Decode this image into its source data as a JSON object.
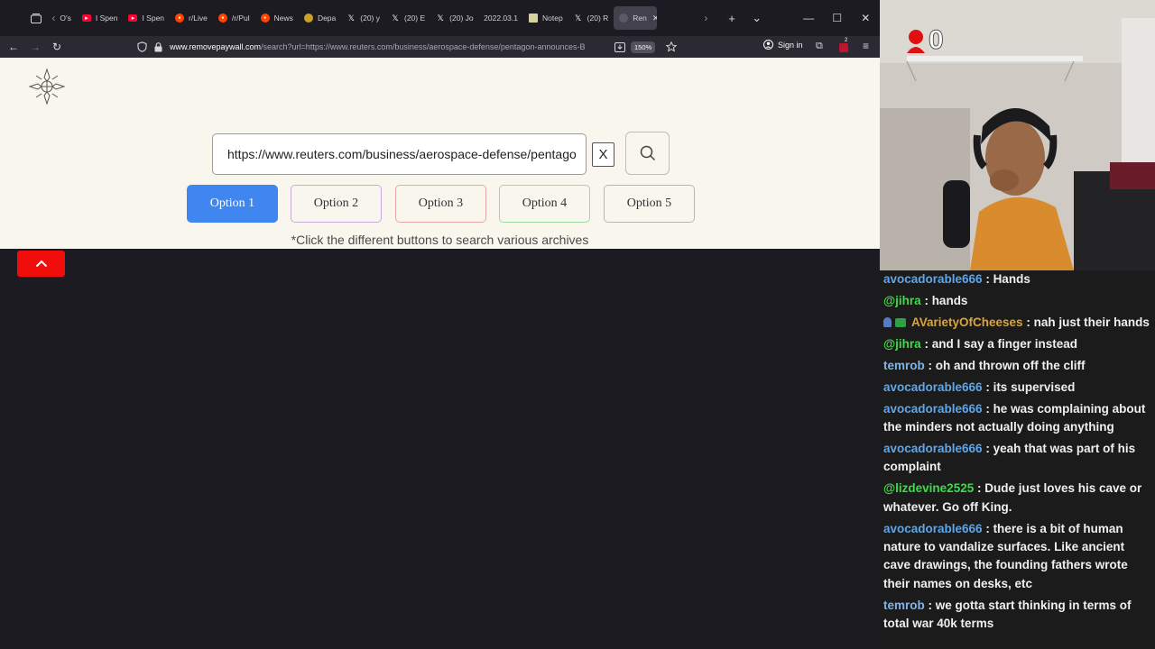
{
  "tabs": [
    {
      "label": "O's",
      "icon": "scroll-left",
      "color": "#8a8a90"
    },
    {
      "label": "I Spen",
      "icon": "youtube",
      "color": "#ff0033"
    },
    {
      "label": "I Spen",
      "icon": "youtube",
      "color": "#ff0033"
    },
    {
      "label": "r/Live",
      "icon": "reddit",
      "color": "#ff4500"
    },
    {
      "label": "/r/Pul",
      "icon": "reddit",
      "color": "#ff4500"
    },
    {
      "label": "News",
      "icon": "reddit",
      "color": "#ff4500"
    },
    {
      "label": "Depa",
      "icon": "globe",
      "color": "#c9a227"
    },
    {
      "label": "(20) y",
      "icon": "x",
      "color": "#e0e0e0"
    },
    {
      "label": "(20) E",
      "icon": "x",
      "color": "#e0e0e0"
    },
    {
      "label": "(20) Jo",
      "icon": "x",
      "color": "#e0e0e0"
    },
    {
      "label": "2022.03.1",
      "icon": "none",
      "color": "#e0e0e0"
    },
    {
      "label": "Notep",
      "icon": "note",
      "color": "#d6d2a0"
    },
    {
      "label": "(20) R",
      "icon": "x",
      "color": "#e0e0e0"
    },
    {
      "label": "Ren",
      "icon": "globe",
      "color": "#5a5a66",
      "active": true
    }
  ],
  "nav": {
    "url_domain": "www.removepaywall.com",
    "url_rest": "/search?url=https://www.reuters.com/business/aerospace-defense/pentagon-announces-B",
    "zoom": "150%",
    "signin": "Sign in",
    "badge": "2"
  },
  "page": {
    "search_value": "https://www.reuters.com/business/aerospace-defense/pentagon-announces-B",
    "clear_label": "X",
    "options": [
      "Option 1",
      "Option 2",
      "Option 3",
      "Option 4",
      "Option 5"
    ],
    "hint": "*Click the different buttons to search various archives"
  },
  "stream": {
    "overlay_count": "0",
    "accent": "#e01010"
  },
  "chat": [
    {
      "user": "avocadorable666",
      "color": "#5fa5e8",
      "text": "Hands"
    },
    {
      "user": "@jihra",
      "color": "#3ddc4a",
      "text": "hands"
    },
    {
      "user": "AVarietyOfCheeses",
      "color": "#d9a43a",
      "text": "nah just their hands",
      "badges": true
    },
    {
      "user": "@jihra",
      "color": "#3ddc4a",
      "text": "and I say a finger instead"
    },
    {
      "user": "temrob",
      "color": "#7fb4e8",
      "text": "oh and thrown off the cliff"
    },
    {
      "user": "avocadorable666",
      "color": "#5fa5e8",
      "text": "its supervised"
    },
    {
      "user": "avocadorable666",
      "color": "#5fa5e8",
      "text": "he was complaining about the minders not actually doing anything"
    },
    {
      "user": "avocadorable666",
      "color": "#5fa5e8",
      "text": "yeah that was part of his complaint"
    },
    {
      "user": "@lizdevine2525",
      "color": "#3ddc4a",
      "text": "Dude just loves his cave or whatever. Go off King."
    },
    {
      "user": "avocadorable666",
      "color": "#5fa5e8",
      "text": "there is a bit of human nature to vandalize surfaces. Like ancient cave drawings, the founding fathers wrote their names on desks, etc"
    },
    {
      "user": "temrob",
      "color": "#7fb4e8",
      "text": "we gotta start thinking in terms of total war 40k terms"
    }
  ]
}
